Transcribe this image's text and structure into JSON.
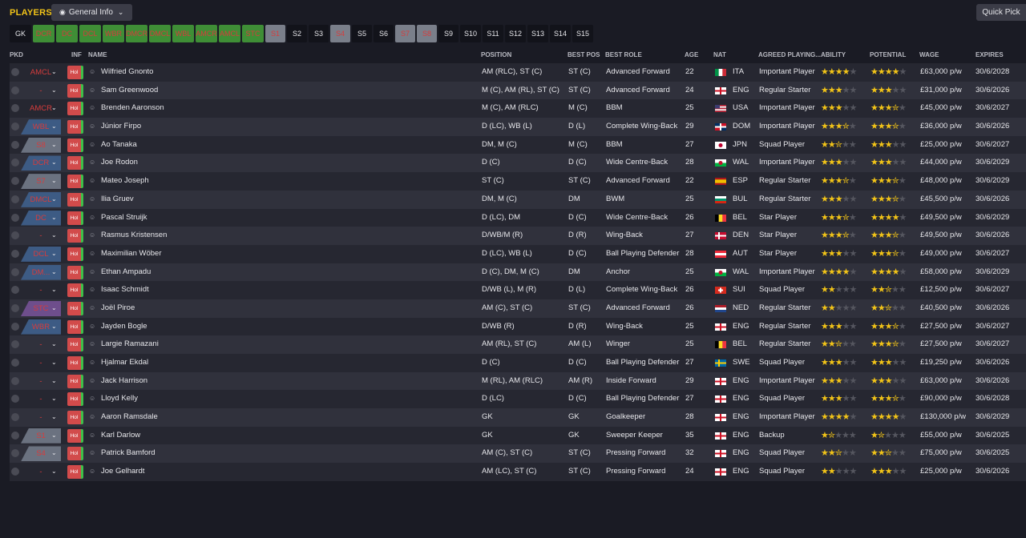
{
  "title": "PLAYERS",
  "view_dropdown": {
    "label": "General Info",
    "icon": "eye-icon"
  },
  "quick_pick": "Quick Pick",
  "slots": [
    {
      "label": "GK",
      "style": "dark",
      "w": 27
    },
    {
      "label": "DCR",
      "style": "green",
      "w": 27
    },
    {
      "label": "DC",
      "style": "green",
      "w": 27
    },
    {
      "label": "DCL",
      "style": "green",
      "w": 27
    },
    {
      "label": "WBR",
      "style": "green",
      "w": 27
    },
    {
      "label": "DMCR",
      "style": "green",
      "w": 27
    },
    {
      "label": "DMCL",
      "style": "green",
      "w": 27
    },
    {
      "label": "WBL",
      "style": "green",
      "w": 27
    },
    {
      "label": "AMCR",
      "style": "green",
      "w": 27
    },
    {
      "label": "AMCL",
      "style": "green",
      "w": 27
    },
    {
      "label": "STC",
      "style": "green",
      "w": 27
    },
    {
      "label": "S1",
      "style": "grey",
      "w": 25
    },
    {
      "label": "S2",
      "style": "dark",
      "w": 25
    },
    {
      "label": "S3",
      "style": "dark",
      "w": 25
    },
    {
      "label": "S4",
      "style": "grey",
      "w": 25
    },
    {
      "label": "S5",
      "style": "dark",
      "w": 25
    },
    {
      "label": "S6",
      "style": "dark",
      "w": 25
    },
    {
      "label": "S7",
      "style": "grey",
      "w": 25
    },
    {
      "label": "S8",
      "style": "grey",
      "w": 25
    },
    {
      "label": "S9",
      "style": "dark",
      "w": 25
    },
    {
      "label": "S10",
      "style": "dark",
      "w": 26
    },
    {
      "label": "S11",
      "style": "dark",
      "w": 26
    },
    {
      "label": "S12",
      "style": "dark",
      "w": 26
    },
    {
      "label": "S13",
      "style": "dark",
      "w": 26
    },
    {
      "label": "S14",
      "style": "dark",
      "w": 26
    },
    {
      "label": "S15",
      "style": "dark",
      "w": 26
    }
  ],
  "columns": {
    "pkd": "PKD",
    "inf": "INF",
    "name": "NAME",
    "position": "POSITION",
    "best_pos": "BEST POS",
    "best_role": "BEST ROLE",
    "age": "AGE",
    "nat": "NAT",
    "agreed": "AGREED PLAYING...",
    "ability": "ABILITY",
    "potential": "POTENTIAL",
    "wage": "WAGE",
    "expires": "EXPIRES"
  },
  "inf_label": "Hol",
  "colors": {
    "accent": "#f2c418",
    "pos_text": "#d63c3c",
    "tag_blue": "#3d5b84",
    "tag_purple": "#6e4e8c",
    "tag_grey": "#6b7280",
    "inf_red": "#d24b4b",
    "inf_green": "#3fbf4a"
  },
  "players": [
    {
      "pkd": "AMCL",
      "tag": "none",
      "name": "Wilfried Gnonto",
      "position": "AM (RLC), ST (C)",
      "best_pos": "ST (C)",
      "best_role": "Advanced Forward",
      "age": "22",
      "nat": "ITA",
      "flag": "ita",
      "agreed": "Important Player",
      "ability": 4,
      "potential": 4,
      "wage": "£63,000 p/w",
      "expires": "30/6/2028"
    },
    {
      "pkd": "-",
      "tag": "none",
      "name": "Sam Greenwood",
      "position": "M (C), AM (RL), ST (C)",
      "best_pos": "ST (C)",
      "best_role": "Advanced Forward",
      "age": "24",
      "nat": "ENG",
      "flag": "eng",
      "agreed": "Regular Starter",
      "ability": 3,
      "potential": 3,
      "wage": "£31,000 p/w",
      "expires": "30/6/2026"
    },
    {
      "pkd": "AMCR",
      "tag": "none",
      "name": "Brenden Aaronson",
      "position": "M (C), AM (RLC)",
      "best_pos": "M (C)",
      "best_role": "BBM",
      "age": "25",
      "nat": "USA",
      "flag": "usa",
      "agreed": "Important Player",
      "ability": 3,
      "potential": 3.5,
      "wage": "£45,000 p/w",
      "expires": "30/6/2027"
    },
    {
      "pkd": "WBL",
      "tag": "blue",
      "name": "Júnior Firpo",
      "position": "D (LC), WB (L)",
      "best_pos": "D (L)",
      "best_role": "Complete Wing-Back",
      "age": "29",
      "nat": "DOM",
      "flag": "dom",
      "agreed": "Important Player",
      "ability": 3.5,
      "potential": 3.5,
      "wage": "£36,000 p/w",
      "expires": "30/6/2026"
    },
    {
      "pkd": "S8",
      "tag": "grey",
      "name": "Ao Tanaka",
      "position": "DM, M (C)",
      "best_pos": "M (C)",
      "best_role": "BBM",
      "age": "27",
      "nat": "JPN",
      "flag": "jpn",
      "agreed": "Squad Player",
      "ability": 2.5,
      "potential": 3,
      "wage": "£25,000 p/w",
      "expires": "30/6/2027"
    },
    {
      "pkd": "DCR",
      "tag": "blue",
      "name": "Joe Rodon",
      "position": "D (C)",
      "best_pos": "D (C)",
      "best_role": "Wide Centre-Back",
      "age": "28",
      "nat": "WAL",
      "flag": "wal",
      "agreed": "Important Player",
      "ability": 3,
      "potential": 3,
      "wage": "£44,000 p/w",
      "expires": "30/6/2029"
    },
    {
      "pkd": "S7",
      "tag": "grey",
      "name": "Mateo Joseph",
      "position": "ST (C)",
      "best_pos": "ST (C)",
      "best_role": "Advanced Forward",
      "age": "22",
      "nat": "ESP",
      "flag": "esp",
      "agreed": "Regular Starter",
      "ability": 3.5,
      "potential": 3.5,
      "wage": "£48,000 p/w",
      "expires": "30/6/2029"
    },
    {
      "pkd": "DMCL",
      "tag": "blue",
      "name": "Ilia Gruev",
      "position": "DM, M (C)",
      "best_pos": "DM",
      "best_role": "BWM",
      "age": "25",
      "nat": "BUL",
      "flag": "bul",
      "agreed": "Regular Starter",
      "ability": 3,
      "potential": 3.5,
      "wage": "£45,500 p/w",
      "expires": "30/6/2026"
    },
    {
      "pkd": "DC",
      "tag": "blue",
      "name": "Pascal Struijk",
      "position": "D (LC), DM",
      "best_pos": "D (C)",
      "best_role": "Wide Centre-Back",
      "age": "26",
      "nat": "BEL",
      "flag": "bel",
      "agreed": "Star Player",
      "ability": 3.5,
      "potential": 4,
      "wage": "£49,500 p/w",
      "expires": "30/6/2029"
    },
    {
      "pkd": "-",
      "tag": "none",
      "name": "Rasmus Kristensen",
      "position": "D/WB/M (R)",
      "best_pos": "D (R)",
      "best_role": "Wing-Back",
      "age": "27",
      "nat": "DEN",
      "flag": "den",
      "agreed": "Star Player",
      "ability": 3.5,
      "potential": 3.5,
      "wage": "£49,500 p/w",
      "expires": "30/6/2026"
    },
    {
      "pkd": "DCL",
      "tag": "blue",
      "name": "Maximilian Wöber",
      "position": "D (LC), WB (L)",
      "best_pos": "D (C)",
      "best_role": "Ball Playing Defender",
      "age": "28",
      "nat": "AUT",
      "flag": "aut",
      "agreed": "Star Player",
      "ability": 3,
      "potential": 3.5,
      "wage": "£49,000 p/w",
      "expires": "30/6/2027"
    },
    {
      "pkd": "DM...",
      "tag": "blue",
      "name": "Ethan Ampadu",
      "position": "D (C), DM, M (C)",
      "best_pos": "DM",
      "best_role": "Anchor",
      "age": "25",
      "nat": "WAL",
      "flag": "wal",
      "agreed": "Important Player",
      "ability": 4,
      "potential": 4,
      "wage": "£58,000 p/w",
      "expires": "30/6/2029"
    },
    {
      "pkd": "-",
      "tag": "none",
      "name": "Isaac Schmidt",
      "position": "D/WB (L), M (R)",
      "best_pos": "D (L)",
      "best_role": "Complete Wing-Back",
      "age": "26",
      "nat": "SUI",
      "flag": "sui",
      "agreed": "Squad Player",
      "ability": 2,
      "potential": 2.5,
      "wage": "£12,500 p/w",
      "expires": "30/6/2027"
    },
    {
      "pkd": "STC",
      "tag": "purple",
      "name": "Joël Piroe",
      "position": "AM (C), ST (C)",
      "best_pos": "ST (C)",
      "best_role": "Advanced Forward",
      "age": "26",
      "nat": "NED",
      "flag": "ned",
      "agreed": "Regular Starter",
      "ability": 2,
      "potential": 2.5,
      "wage": "£40,500 p/w",
      "expires": "30/6/2026"
    },
    {
      "pkd": "WBR",
      "tag": "blue",
      "name": "Jayden Bogle",
      "position": "D/WB (R)",
      "best_pos": "D (R)",
      "best_role": "Wing-Back",
      "age": "25",
      "nat": "ENG",
      "flag": "eng",
      "agreed": "Regular Starter",
      "ability": 3,
      "potential": 3.5,
      "wage": "£27,500 p/w",
      "expires": "30/6/2027"
    },
    {
      "pkd": "-",
      "tag": "none",
      "name": "Largie Ramazani",
      "position": "AM (RL), ST (C)",
      "best_pos": "AM (L)",
      "best_role": "Winger",
      "age": "25",
      "nat": "BEL",
      "flag": "bel",
      "agreed": "Regular Starter",
      "ability": 2.5,
      "potential": 3.5,
      "wage": "£27,500 p/w",
      "expires": "30/6/2027"
    },
    {
      "pkd": "-",
      "tag": "none",
      "name": "Hjalmar Ekdal",
      "position": "D (C)",
      "best_pos": "D (C)",
      "best_role": "Ball Playing Defender",
      "age": "27",
      "nat": "SWE",
      "flag": "swe",
      "agreed": "Squad Player",
      "ability": 3,
      "potential": 3,
      "wage": "£19,250 p/w",
      "expires": "30/6/2026"
    },
    {
      "pkd": "-",
      "tag": "none",
      "name": "Jack Harrison",
      "position": "M (RL), AM (RLC)",
      "best_pos": "AM (R)",
      "best_role": "Inside Forward",
      "age": "29",
      "nat": "ENG",
      "flag": "eng",
      "agreed": "Important Player",
      "ability": 3,
      "potential": 3,
      "wage": "£63,000 p/w",
      "expires": "30/6/2026"
    },
    {
      "pkd": "-",
      "tag": "none",
      "name": "Lloyd Kelly",
      "position": "D (LC)",
      "best_pos": "D (C)",
      "best_role": "Ball Playing Defender",
      "age": "27",
      "nat": "ENG",
      "flag": "eng",
      "agreed": "Squad Player",
      "ability": 3,
      "potential": 3.5,
      "wage": "£90,000 p/w",
      "expires": "30/6/2028"
    },
    {
      "pkd": "-",
      "tag": "none",
      "name": "Aaron Ramsdale",
      "position": "GK",
      "best_pos": "GK",
      "best_role": "Goalkeeper",
      "age": "28",
      "nat": "ENG",
      "flag": "eng",
      "agreed": "Important Player",
      "ability": 4,
      "potential": 4,
      "wage": "£130,000 p/w",
      "expires": "30/6/2029"
    },
    {
      "pkd": "S1",
      "tag": "grey",
      "name": "Karl Darlow",
      "position": "GK",
      "best_pos": "GK",
      "best_role": "Sweeper Keeper",
      "age": "35",
      "nat": "ENG",
      "flag": "eng",
      "agreed": "Backup",
      "ability": 1.5,
      "potential": 1.5,
      "wage": "£55,000 p/w",
      "expires": "30/6/2025"
    },
    {
      "pkd": "S4",
      "tag": "grey",
      "name": "Patrick Bamford",
      "position": "AM (C), ST (C)",
      "best_pos": "ST (C)",
      "best_role": "Pressing Forward",
      "age": "32",
      "nat": "ENG",
      "flag": "eng",
      "agreed": "Squad Player",
      "ability": 2.5,
      "potential": 2.5,
      "wage": "£75,000 p/w",
      "expires": "30/6/2025"
    },
    {
      "pkd": "-",
      "tag": "none",
      "name": "Joe Gelhardt",
      "position": "AM (LC), ST (C)",
      "best_pos": "ST (C)",
      "best_role": "Pressing Forward",
      "age": "24",
      "nat": "ENG",
      "flag": "eng",
      "agreed": "Squad Player",
      "ability": 2,
      "potential": 3,
      "wage": "£25,000 p/w",
      "expires": "30/6/2026"
    }
  ]
}
